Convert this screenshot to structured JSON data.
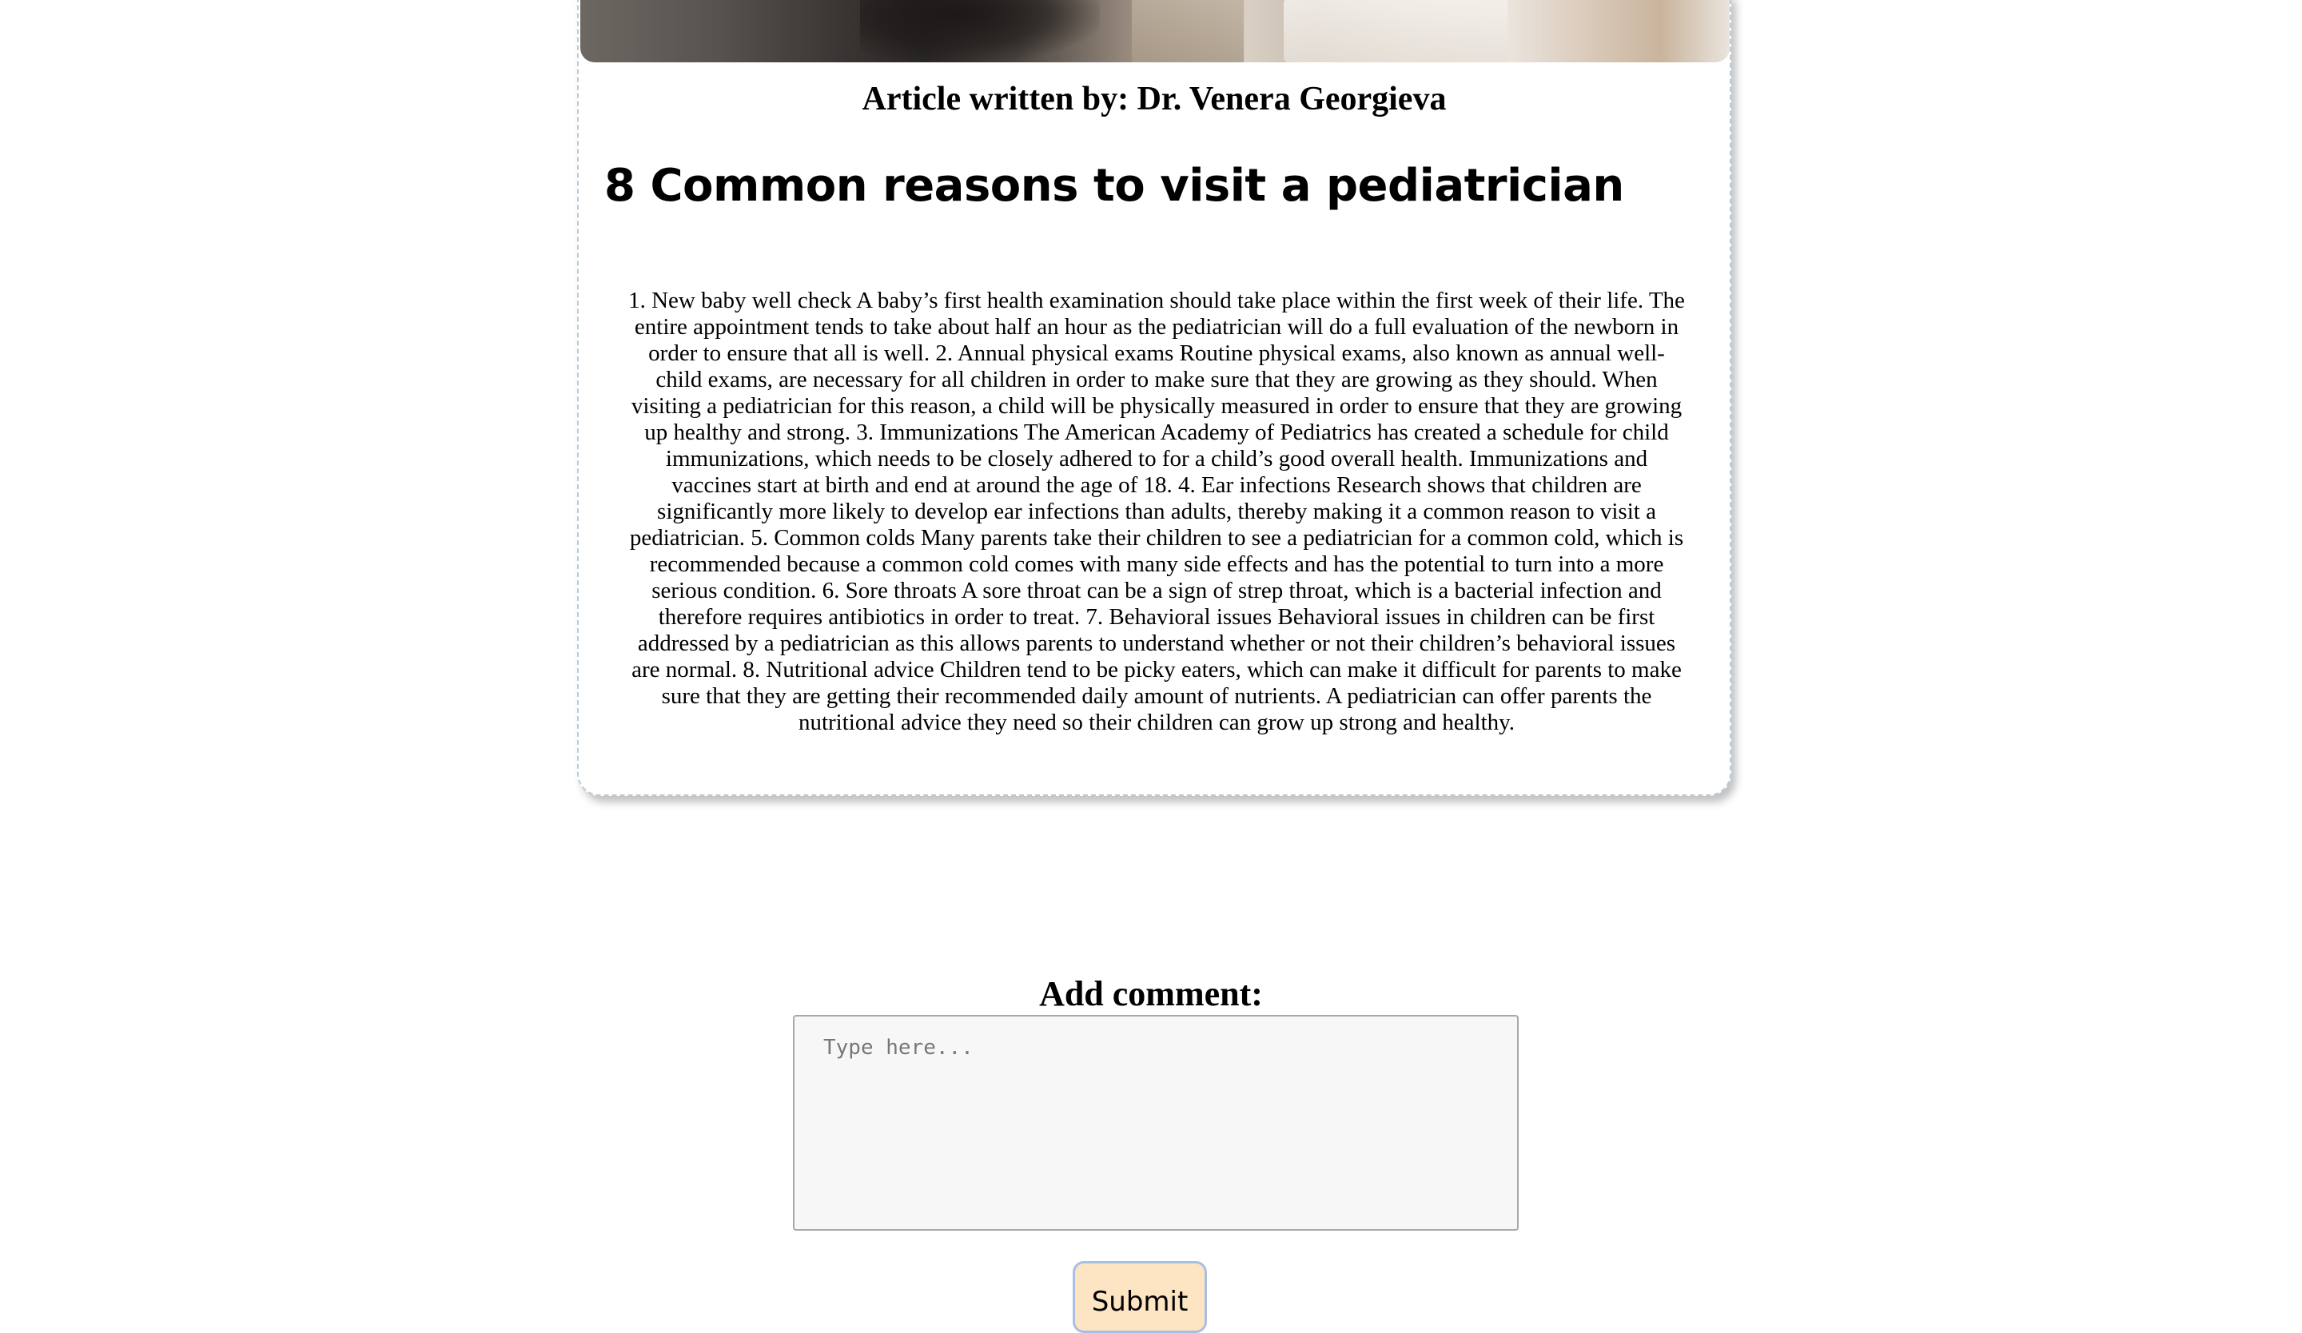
{
  "article": {
    "author_line": "Article written by: Dr. Venera Georgieva",
    "title": "8 Common reasons to visit a pediatrician",
    "body": "1. New baby well check A baby’s first health examination should take place within the first week of their life. The entire appointment tends to take about half an hour as the pediatrician will do a full evaluation of the newborn in order to ensure that all is well. 2. Annual physical exams Routine physical exams, also known as annual well-child exams, are necessary for all children in order to make sure that they are growing as they should. When visiting a pediatrician for this reason, a child will be physically measured in order to ensure that they are growing up healthy and strong. 3. Immunizations The American Academy of Pediatrics has created a schedule for child immunizations, which needs to be closely adhered to for a child’s good overall health. Immunizations and vaccines start at birth and end at around the age of 18. 4. Ear infections Research shows that children are significantly more likely to develop ear infections than adults, thereby making it a common reason to visit a pediatrician. 5. Common colds Many parents take their children to see a pediatrician for a common cold, which is recommended because a common cold comes with many side effects and has the potential to turn into a more serious condition. 6. Sore throats A sore throat can be a sign of strep throat, which is a bacterial infection and therefore requires antibiotics in order to treat. 7. Behavioral issues Behavioral issues in children can be first addressed by a pediatrician as this allows parents to understand whether or not their children’s behavioral issues are normal. 8. Nutritional advice Children tend to be picky eaters, which can make it difficult for parents to make sure that they are getting their recommended daily amount of nutrients. A pediatrician can offer parents the nutritional advice they need so their children can grow up strong and healthy."
  },
  "comment": {
    "heading": "Add comment:",
    "placeholder": "Type here...",
    "value": "",
    "submit_label": "Submit"
  },
  "colors": {
    "card_border": "#b9cbd8",
    "submit_background": "#fde4c3",
    "submit_border": "#a7bfe6",
    "input_background": "#f7f7f7"
  }
}
